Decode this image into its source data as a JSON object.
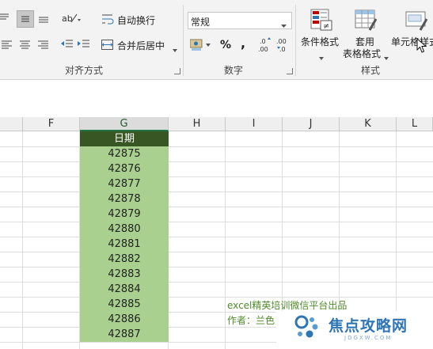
{
  "ribbon": {
    "alignment": {
      "wrap_text": "自动换行",
      "merge_center": "合并后居中",
      "group_label": "对齐方式"
    },
    "number": {
      "format_value": "常规",
      "percent": "%",
      "comma": ",",
      "group_label": "数字"
    },
    "styles": {
      "conditional_format": "条件格式",
      "table_format_line1": "套用",
      "table_format_line2": "表格格式",
      "cell_styles": "单元格样式",
      "group_label": "样式"
    }
  },
  "columns": [
    "F",
    "G",
    "H",
    "I",
    "J",
    "K",
    "L"
  ],
  "sheet": {
    "header": "日期",
    "values": [
      "42875",
      "42876",
      "42877",
      "42878",
      "42879",
      "42880",
      "42881",
      "42882",
      "42883",
      "42884",
      "42885",
      "42886",
      "42887"
    ]
  },
  "notes": {
    "line1": "excel精英培训微信平台出品",
    "line2": "作者：兰色"
  },
  "watermark": {
    "text": "焦点攻略网",
    "sub": "JDGXW.COM"
  },
  "colors": {
    "header_fill": "#375623",
    "data_fill": "#a9d08e",
    "accent": "#217346"
  }
}
